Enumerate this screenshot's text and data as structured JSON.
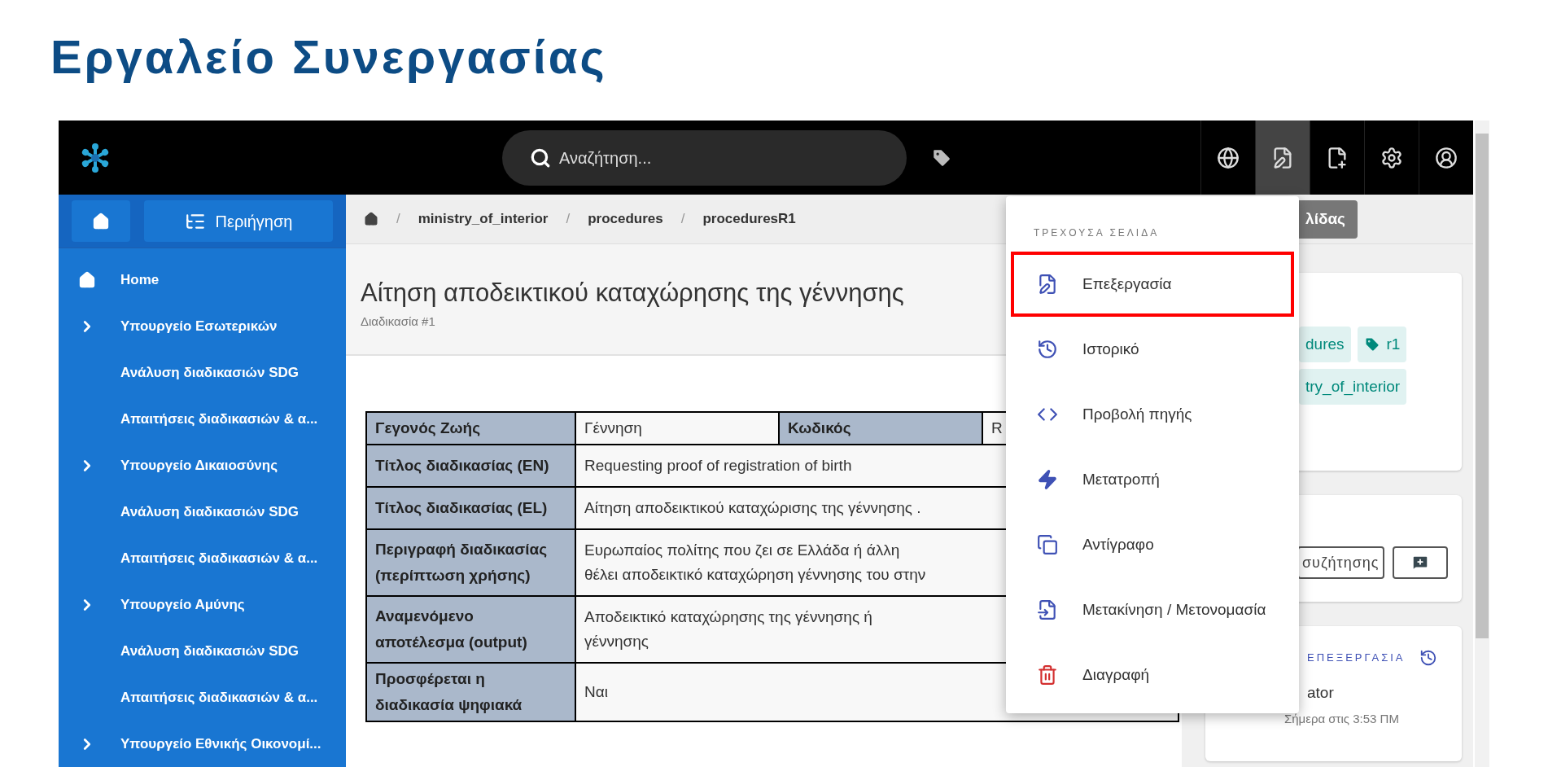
{
  "page_title": "Εργαλείο Συνεργασίας",
  "top_bar": {
    "search": {
      "placeholder": "Αναζήτηση..."
    },
    "icons": [
      {
        "kind": "globe",
        "selected": false
      },
      {
        "kind": "edit",
        "selected": true
      },
      {
        "kind": "note-add",
        "selected": false
      },
      {
        "kind": "settings",
        "selected": false
      },
      {
        "kind": "account",
        "selected": false
      }
    ]
  },
  "sidebar": {
    "browse_button": "Περιήγηση",
    "items": [
      {
        "kind": "home",
        "label": "Home"
      },
      {
        "kind": "group",
        "label": "Υπουργείο Εσωτερικών"
      },
      {
        "kind": "page",
        "label": "Ανάλυση διαδικασιών SDG"
      },
      {
        "kind": "page",
        "label": "Απαιτήσεις διαδικασιών & α..."
      },
      {
        "kind": "group",
        "label": "Υπουργείο Δικαιοσύνης"
      },
      {
        "kind": "page",
        "label": "Ανάλυση διαδικασιών SDG"
      },
      {
        "kind": "page",
        "label": "Απαιτήσεις διαδικασιών & α..."
      },
      {
        "kind": "group",
        "label": "Υπουργείο Αμύνης"
      },
      {
        "kind": "page",
        "label": "Ανάλυση διαδικασιών SDG"
      },
      {
        "kind": "page",
        "label": "Απαιτήσεις διαδικασιών & α..."
      },
      {
        "kind": "group",
        "label": "Υπουργείο Εθνικής Οικονομί..."
      }
    ]
  },
  "breadcrumbs": [
    {
      "separator": "/",
      "label": "ministry_of_interior"
    },
    {
      "separator": "/",
      "label": "procedures"
    },
    {
      "separator": "/",
      "label": "proceduresR1"
    }
  ],
  "header_button": "λίδας",
  "document": {
    "title": "Αίτηση αποδεικτικού καταχώρησης της γέννησης",
    "subtitle": "Διαδικασία #1"
  },
  "table": {
    "rows": [
      {
        "kind": "split",
        "label": "Γεγονός Ζωής",
        "value": "Γέννηση",
        "label_2": "Κωδικός",
        "value_2": "R"
      },
      {
        "kind": "pair",
        "label": "Τίτλος διαδικασίας (EN)",
        "value": "Requesting proof of registration of birth"
      },
      {
        "kind": "pair",
        "label": "Τίτλος διαδικασίας (EL)",
        "value": "Αίτηση αποδεικτικού καταχώρισης της γέννησης ."
      },
      {
        "kind": "pair",
        "label": "Περιγραφή διαδικασίας (περίπτωση χρήσης)",
        "value": "Ευρωπαίος πολίτης που ζει σε Ελλάδα ή άλλη\nθέλει αποδεικτικό καταχώρηση γέννησης του στην"
      },
      {
        "kind": "pair",
        "label": "Αναμενόμενο αποτέλεσμα (output)",
        "value": "Αποδεικτικό καταχώρησης της γέννησης ή\nγέννησης"
      },
      {
        "kind": "pair",
        "label": "Προσφέρεται η διαδικασία ψηφιακά",
        "value": "Ναι"
      }
    ]
  },
  "right_panel": {
    "tags": [
      {
        "label": "dures",
        "icon": false
      },
      {
        "label": "r1",
        "icon": true
      },
      {
        "label": "try_of_interior",
        "icon": false
      }
    ],
    "discussion_button": "συζήτησης",
    "last_edit": {
      "heading": "ΕΠΕΞΕΡΓΑΣΙΑ",
      "user": "ator",
      "time": "Σήμερα στις 3:53 ΠΜ"
    }
  },
  "menu": {
    "heading": "ΤΡΕΧΟΥΣΑ ΣΕΛΙΔΑ",
    "items": [
      {
        "kind": "edit",
        "label": "Επεξεργασία",
        "highlighted": true
      },
      {
        "kind": "history",
        "label": "Ιστορικό",
        "highlighted": false
      },
      {
        "kind": "source",
        "label": "Προβολή πηγής",
        "highlighted": false
      },
      {
        "kind": "convert",
        "label": "Μετατροπή",
        "highlighted": false
      },
      {
        "kind": "copy",
        "label": "Αντίγραφο",
        "highlighted": false
      },
      {
        "kind": "move",
        "label": "Μετακίνηση / Μετονομασία",
        "highlighted": false
      },
      {
        "kind": "delete",
        "label": "Διαγραφή",
        "highlighted": false
      }
    ]
  }
}
